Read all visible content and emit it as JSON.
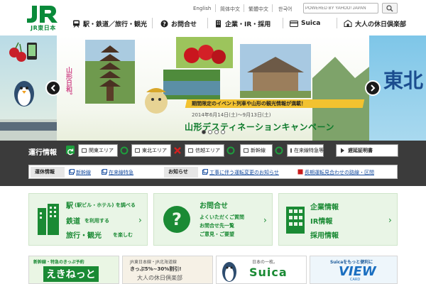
{
  "header": {
    "logo_text": "JR東日本",
    "languages": [
      "English",
      "简体中文",
      "繁體中文",
      "한국어"
    ],
    "search": {
      "placeholder": "POWERED BY YAHOO! JAPAN"
    },
    "nav": [
      {
        "label": "駅・鉄道／旅行・観光",
        "icon": "train-icon"
      },
      {
        "label": "お問合せ",
        "icon": "question-icon"
      },
      {
        "label": "企業・IR・採用",
        "icon": "building-icon"
      },
      {
        "label": "Suica",
        "icon": "card-icon"
      },
      {
        "label": "大人の休日倶楽部",
        "icon": "club-icon"
      }
    ]
  },
  "hero": {
    "catch": "期間限定のイベント列車や山形の観光情報が満載！",
    "dates": "2014年6月14日(土)〜9月13日(土)",
    "title": "山形デスティネーションキャンペーン",
    "mascot_text": "山形日和。",
    "side_right_text": "東北",
    "prev_icon": "chevron-left-icon",
    "next_icon": "chevron-right-icon",
    "slide_count": 4,
    "active_slide": 1
  },
  "operation": {
    "title": "運行情報",
    "areas": [
      {
        "label": "関東エリア",
        "status": "ok"
      },
      {
        "label": "東北エリア",
        "status": "delay"
      },
      {
        "label": "信越エリア",
        "status": "ok"
      },
      {
        "label": "新幹線",
        "status": "ok"
      },
      {
        "label": "在来線特急等",
        "status": "ok"
      }
    ],
    "cert_button": "遅延証明書",
    "row2": {
      "suspension_label": "運休情報",
      "suspension_links": [
        "新幹線",
        "在来線特急"
      ],
      "notice_label": "お知らせ",
      "notice_links": [
        "工事に伴う運転変更のお知らせ",
        "長期運転見合わせの路線・区間"
      ]
    },
    "colors": {
      "ok": "#1e9e3d",
      "delay": "#d42020"
    }
  },
  "tiles": [
    {
      "lines": [
        "駅",
        "(駅ビル・ホテル) を調べる",
        "鉄道",
        "を利用する",
        "旅行・観光",
        "を楽しむ"
      ],
      "icon": "building-icon"
    },
    {
      "lines": [
        "お問合せ",
        "よくいただくご質問",
        "お問合せ先一覧",
        "ご意見・ご要望"
      ],
      "icon": "question-icon"
    },
    {
      "lines": [
        "企業情報",
        "IR情報",
        "採用情報"
      ],
      "icon": "office-building-icon"
    }
  ],
  "banners": [
    {
      "top": "新幹線・特急のきっぷ予約",
      "main": "えきねっと"
    },
    {
      "top": "JR東日本線・JR北海道線",
      "main": "きっぷ5%~30%割引!",
      "sub": "大人の休日倶楽部"
    },
    {
      "top": "日本の一枚。",
      "main": "Suica"
    },
    {
      "top": "Suicaをもっと便利に",
      "main": "VIEW",
      "sub": "CARD"
    }
  ]
}
